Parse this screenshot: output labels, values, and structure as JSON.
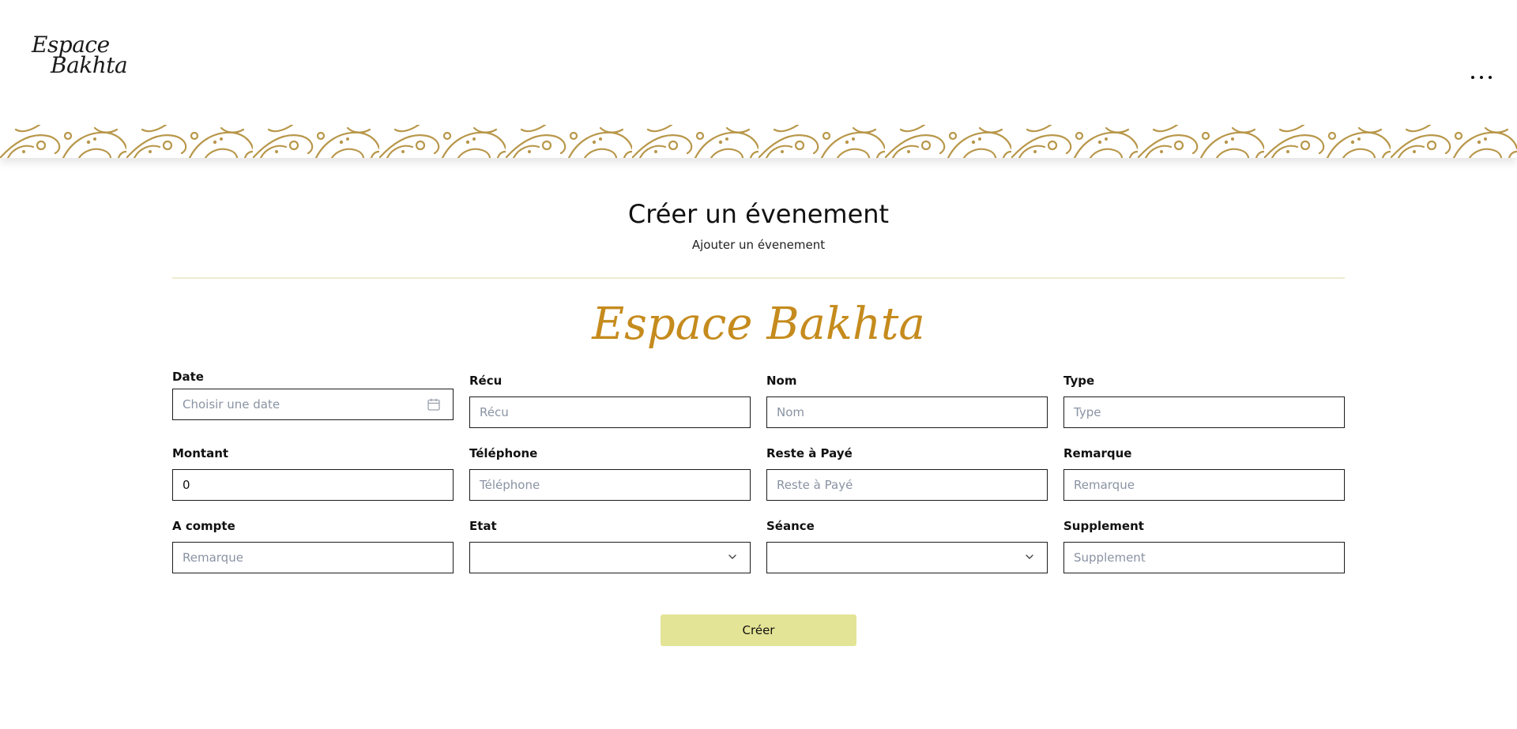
{
  "header": {
    "logo_line1": "Espace",
    "logo_line2": "Bakhta",
    "menu_icon": "more-horizontal-icon"
  },
  "page": {
    "title": "Créer un évenement",
    "subtitle": "Ajouter un évenement",
    "brand": "Espace Bakhta"
  },
  "form": {
    "date": {
      "label": "Date",
      "placeholder": "Choisir une date",
      "icon": "calendar-icon"
    },
    "recu": {
      "label": "Récu",
      "placeholder": "Récu"
    },
    "nom": {
      "label": "Nom",
      "placeholder": "Nom"
    },
    "type": {
      "label": "Type",
      "placeholder": "Type"
    },
    "montant": {
      "label": "Montant",
      "value": "0"
    },
    "telephone": {
      "label": "Téléphone",
      "placeholder": "Téléphone"
    },
    "reste": {
      "label": "Reste à Payé",
      "placeholder": "Reste à Payé"
    },
    "remarque": {
      "label": "Remarque",
      "placeholder": "Remarque"
    },
    "acompte": {
      "label": "A compte",
      "placeholder": "Remarque"
    },
    "etat": {
      "label": "Etat",
      "value": ""
    },
    "seance": {
      "label": "Séance",
      "value": ""
    },
    "supplement": {
      "label": "Supplement",
      "placeholder": "Supplement"
    },
    "submit_label": "Créer"
  },
  "colors": {
    "brand": "#c58b1d",
    "ornament": "#b8974a",
    "button": "#e4e496",
    "divider": "#eeeccc"
  }
}
